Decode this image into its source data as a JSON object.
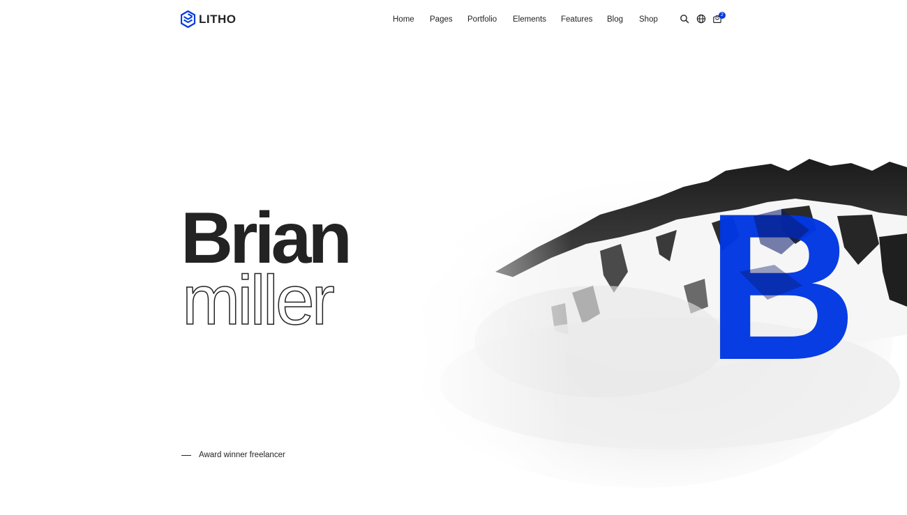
{
  "brand": {
    "name": "LITHO",
    "accent_color": "#0038e3",
    "logo_icon": "hexagon-cube-icon"
  },
  "nav": {
    "items": [
      {
        "label": "Home"
      },
      {
        "label": "Pages"
      },
      {
        "label": "Portfolio"
      },
      {
        "label": "Elements"
      },
      {
        "label": "Features"
      },
      {
        "label": "Blog"
      },
      {
        "label": "Shop"
      }
    ]
  },
  "header_icons": {
    "search": "search-icon",
    "language": "globe-icon",
    "cart": "cart-icon",
    "cart_count": "2"
  },
  "hero": {
    "first_name": "Brian",
    "last_name": "miller",
    "monogram": "B",
    "tagline": "Award winner freelancer",
    "background_image": "snowy-mountain-ridge"
  }
}
